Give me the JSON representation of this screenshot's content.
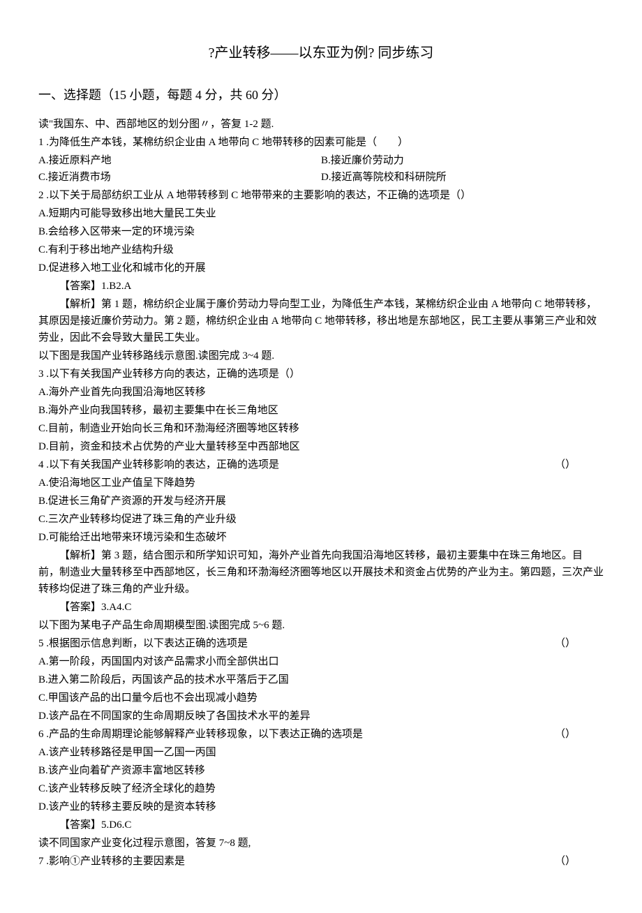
{
  "title": "?产业转移——以东亚为例? 同步练习",
  "section_header": "一、选择题（15 小题，每题 4 分，共 60 分）",
  "intro1": "读\"我国东、中、西部地区的划分图〃，答复 1-2 题.",
  "q1": {
    "stem": "1 .为降低生产本钱，某棉纺织企业由 A 地带向 C 地带转移的因素可能是（　　）",
    "optA": "A.接近原料产地",
    "optB": "B.接近廉价劳动力",
    "optC": "C.接近消费市场",
    "optD": "D.接近高等院校和科研院所"
  },
  "q2": {
    "stem": "2 .以下关于局部纺织工业从 A 地带转移到 C 地带带来的主要影响的表达，不正确的选项是（）",
    "optA": "A.短期内可能导致移出地大量民工失业",
    "optB": "B.会给移入区带来一定的环境污染",
    "optC": "C.有利于移出地产业结构升级",
    "optD": "D.促进移入地工业化和城市化的开展"
  },
  "answer12_label": "【答案】",
  "answer12_text": "1.B2.A",
  "analysis12_label": "【解析】",
  "analysis12_text": "第 1 题，棉纺织企业属于廉价劳动力导向型工业，为降低生产本钱，某棉纺织企业由 A 地带向 C 地带转移，其原因是接近廉价劳动力。第 2 题，棉纺织企业由 A 地带向 C 地带转移，移出地是东部地区，民工主要从事第三产业和效劳业，因此不会导致大量民工失业。",
  "intro34": "以下图是我国产业转移路线示意图.读图完成 3~4 题.",
  "q3": {
    "stem": "3 .以下有关我国产业转移方向的表达，正确的选项是（）",
    "optA": "A.海外产业首先向我国沿海地区转移",
    "optB": "B.海外产业向我国转移，最初主要集中在长三角地区",
    "optC": "C.目前，制造业开始向长三角和环渤海经济圈等地区转移",
    "optD": "D.目前，资金和技术占优势的产业大量转移至中西部地区"
  },
  "q4": {
    "stem": "4 .以下有关我国产业转移影响的表达，正确的选项是",
    "paren": "（）",
    "optA": "A.使沿海地区工业产值呈下降趋势",
    "optB": "B.促进长三角矿产资源的开发与经济开展",
    "optC": "C.三次产业转移均促进了珠三角的产业升级",
    "optD": "D.可能给迁出地带来环境污染和生态破坏"
  },
  "analysis34_label": "【解析】",
  "analysis34_text": "第 3 题，结合图示和所学知识可知，海外产业首先向我国沿海地区转移，最初主要集中在珠三角地区。目前，制造业大量转移至中西部地区，长三角和环渤海经济圈等地区以开展技术和资金占优势的产业为主。第四题，三次产业转移均促进了珠三角的产业升级。",
  "answer34_label": "【答案】",
  "answer34_text": "3.A4.C",
  "intro56": "以下图为某电子产品生命周期模型图.读图完成 5~6 题.",
  "q5": {
    "stem": "5 .根据图示信息判断，以下表达正确的选项是",
    "paren": "（）",
    "optA": "A.第一阶段，丙国国内对该产品需求小而全部供出口",
    "optB": "B.进入第二阶段后，丙国该产品的技术水平落后于乙国",
    "optC": "C.甲国该产品的出口量今后也不会出现减小趋势",
    "optD": "D.该产品在不同国家的生命周期反映了各国技术水平的差异"
  },
  "q6": {
    "stem": "6 .产品的生命周期理论能够解释产业转移现象，以下表达正确的选项是",
    "paren": "（）",
    "optA": "A.该产业转移路径是甲国一乙国一丙国",
    "optB": "B.该产业向着矿产资源丰富地区转移",
    "optC": "C.该产业转移反映了经济全球化的趋势",
    "optD": "D.该产业的转移主要反映的是资本转移"
  },
  "answer56_label": "【答案】",
  "answer56_text": "5.D6.C",
  "intro78": "读不同国家产业变化过程示意图，答复 7~8 题,",
  "q7": {
    "stem": "7 .影响①产业转移的主要因素是",
    "paren": "（）"
  }
}
